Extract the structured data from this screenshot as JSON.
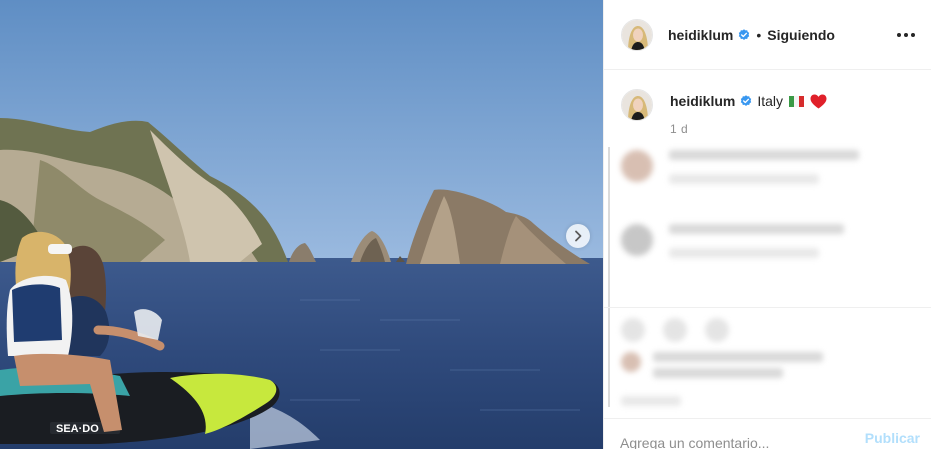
{
  "post": {
    "photo": {
      "description_icon": "jet-ski-photo",
      "next_icon": "chevron-right-icon"
    },
    "header": {
      "username": "heidiklum",
      "separator": "•",
      "follow_label": "Siguiendo",
      "more_icon": "more-options-icon"
    },
    "caption": {
      "username": "heidiklum",
      "text": "Italy",
      "flag_icon": "italy-flag-icon",
      "heart_icon": "red-heart-icon",
      "time": "1 d"
    },
    "comment_bar": {
      "placeholder": "Agrega un comentario...",
      "publish_label": "Publicar"
    },
    "colors": {
      "verified": "#3897f0",
      "publish": "#b2dffc",
      "muted": "#8e8e8e",
      "text": "#262626"
    }
  }
}
